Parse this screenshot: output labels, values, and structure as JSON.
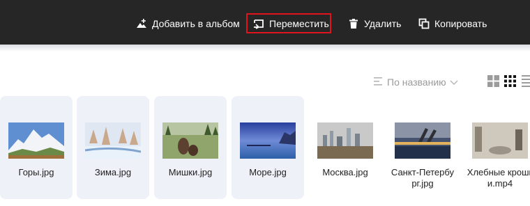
{
  "toolbar": {
    "add_to_album": "Добавить в альбом",
    "move": "Переместить",
    "delete": "Удалить",
    "copy": "Копировать",
    "highlight_color": "#e1131c",
    "background_color": "#262626"
  },
  "sort": {
    "label": "По названию",
    "icon": "sort-lines-icon",
    "chevron": "chevron-down-icon"
  },
  "view_modes": [
    "large-tiles-icon",
    "small-tiles-icon",
    "list-icon"
  ],
  "files": [
    {
      "name": "Горы.jpg",
      "selected": true
    },
    {
      "name": "Зима.jpg",
      "selected": true
    },
    {
      "name": "Мишки.jpg",
      "selected": true
    },
    {
      "name": "Море.jpg",
      "selected": true
    },
    {
      "name": "Москва.jpg",
      "selected": false
    },
    {
      "name": "Санкт-Петербург.jpg",
      "selected": false
    },
    {
      "name": "Хлебные крошки.mp4",
      "selected": false
    }
  ]
}
